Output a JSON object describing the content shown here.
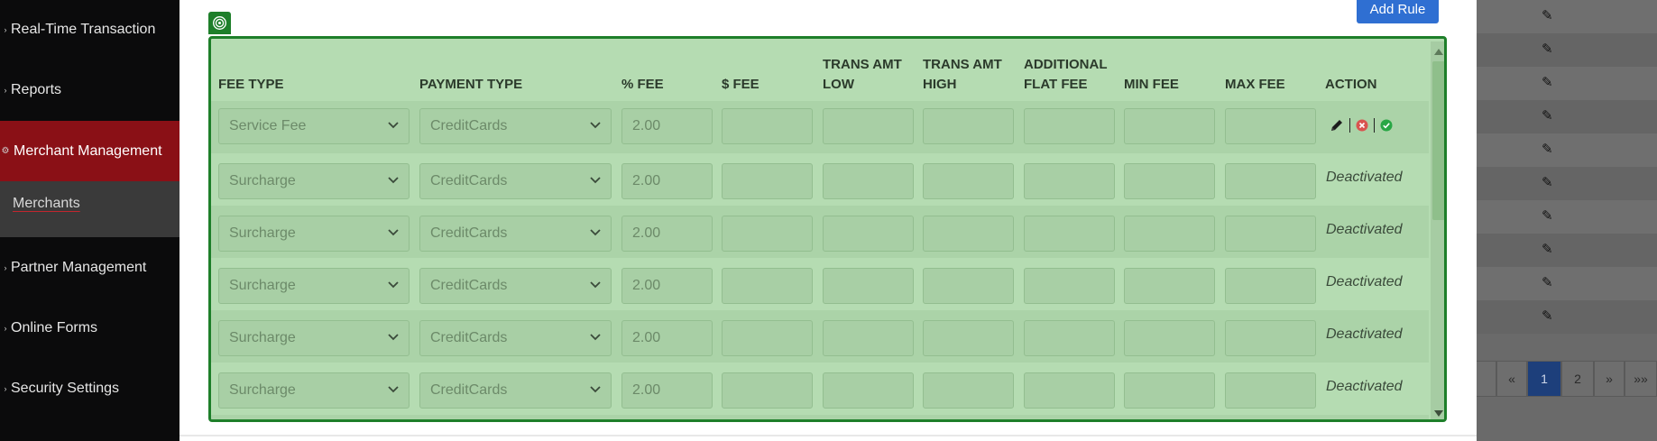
{
  "sidebar": {
    "items": [
      {
        "label": "Real-Time Transaction"
      },
      {
        "label": "Reports"
      },
      {
        "label": "Merchant Management"
      },
      {
        "label": "Partner Management"
      },
      {
        "label": "Online Forms"
      },
      {
        "label": "Security Settings"
      }
    ],
    "sub_item": "Merchants"
  },
  "modal": {
    "add_rule_label": "Add Rule",
    "headers": {
      "fee_type": "FEE TYPE",
      "payment_type": "PAYMENT TYPE",
      "pct_fee": "% FEE",
      "dollar_fee": "$ FEE",
      "trans_amt_low": "TRANS AMT LOW",
      "trans_amt_high": "TRANS AMT HIGH",
      "additional_flat_fee": "ADDITIONAL FLAT FEE",
      "min_fee": "MIN FEE",
      "max_fee": "MAX FEE",
      "action": "ACTION"
    },
    "rows": [
      {
        "fee_type": "Service Fee",
        "payment_type": "CreditCards",
        "pct_fee": "2.00",
        "status": ""
      },
      {
        "fee_type": "Surcharge",
        "payment_type": "CreditCards",
        "pct_fee": "2.00",
        "status": "Deactivated"
      },
      {
        "fee_type": "Surcharge",
        "payment_type": "CreditCards",
        "pct_fee": "2.00",
        "status": "Deactivated"
      },
      {
        "fee_type": "Surcharge",
        "payment_type": "CreditCards",
        "pct_fee": "2.00",
        "status": "Deactivated"
      },
      {
        "fee_type": "Surcharge",
        "payment_type": "CreditCards",
        "pct_fee": "2.00",
        "status": "Deactivated"
      },
      {
        "fee_type": "Surcharge",
        "payment_type": "CreditCards",
        "pct_fee": "2.00",
        "status": "Deactivated"
      }
    ]
  },
  "pagination": {
    "first": "«",
    "page1": "1",
    "page2": "2",
    "next": "»",
    "last": "»»"
  },
  "icons": {
    "edit": "pencil-icon",
    "cancel": "x-circle-icon",
    "confirm": "check-circle-icon",
    "target": "target-icon"
  },
  "colors": {
    "panel_border": "#1e7f2a",
    "panel_bg": "#b5dcb2",
    "active_nav": "#8a1016",
    "add_rule": "#2f6fd2",
    "pagination_active": "#1d3f7b"
  }
}
